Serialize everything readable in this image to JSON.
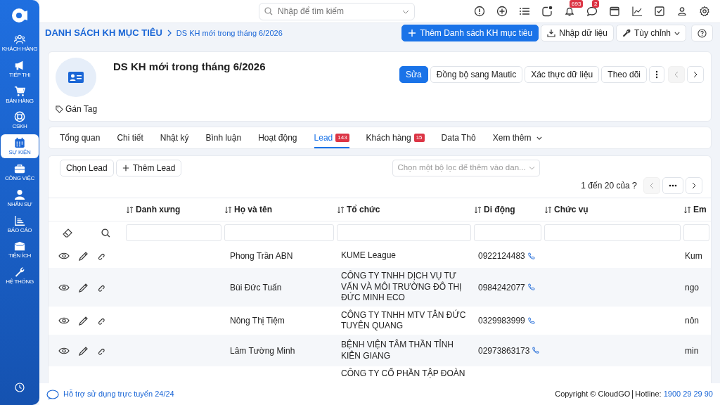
{
  "sidebar": {
    "items": [
      {
        "label": "KHÁCH HÀNG",
        "selected": false
      },
      {
        "label": "TIẾP THỊ",
        "selected": false
      },
      {
        "label": "BÁN HÀNG",
        "selected": false
      },
      {
        "label": "CSKH",
        "selected": false
      },
      {
        "label": "SỰ KIỆN",
        "selected": true
      },
      {
        "label": "CÔNG VIỆC",
        "selected": false
      },
      {
        "label": "NHÂN SỰ",
        "selected": false
      },
      {
        "label": "BÁO CÁO",
        "selected": false
      },
      {
        "label": "TIỆN ÍCH",
        "selected": false
      },
      {
        "label": "HỆ THỐNG",
        "selected": false
      }
    ]
  },
  "topbar": {
    "search": {
      "placeholder": "Nhập để tìm kiếm"
    },
    "bell_badge": "693",
    "chat_badge": "2"
  },
  "breadcrumb": [
    "DANH SÁCH KH MỤC TIÊU",
    "DS KH mới trong tháng 6/2026"
  ],
  "header_actions": [
    "Thêm Danh sách KH mục tiêu",
    "Nhập dữ liệu",
    "Tùy chỉnh"
  ],
  "record": {
    "title": "DS KH mới trong tháng 6/2026",
    "tag_label": "Gán Tag",
    "buttons": [
      {
        "label": "Sửa",
        "kind": "primary"
      },
      {
        "label": "Đồng bộ sang Mautic",
        "kind": "default"
      },
      {
        "label": "Xác thực dữ liệu",
        "kind": "default"
      },
      {
        "label": "Theo dõi",
        "kind": "default"
      }
    ]
  },
  "tabs": [
    {
      "label": "Tổng quan",
      "selected": false
    },
    {
      "label": "Chi tiết",
      "selected": false
    },
    {
      "label": "Nhật ký",
      "selected": false
    },
    {
      "label": "Bình luận",
      "selected": false
    },
    {
      "label": "Hoạt động",
      "selected": false
    },
    {
      "label": "Lead",
      "selected": true,
      "badge": "143"
    },
    {
      "label": "Khách hàng",
      "selected": false,
      "badge": "15"
    },
    {
      "label": "Data Thô",
      "selected": false
    },
    {
      "label": "Xem thêm",
      "selected": false,
      "kind": "more"
    }
  ],
  "lead_panel": {
    "buttons": [
      "Chọn Lead",
      "Thêm Lead"
    ],
    "filter": {
      "placeholder": "Chọn một bộ lọc để thêm vào dan..."
    },
    "pagination": "1 đến 20 của",
    "pagination_total": "?"
  },
  "table": {
    "columns": [
      "Danh xưng",
      "Họ và tên",
      "Tổ chức",
      "Di động",
      "Chức vụ",
      "Em"
    ],
    "rows": [
      {
        "name": "Phong Trần ABN",
        "organization": "KUME League",
        "mobile": "0922124483",
        "column_6": "Kum"
      },
      {
        "name": "Bùi Đức Tuấn",
        "organization": "CÔNG TY TNHH DỊCH VỤ TƯ VẤN VÀ MÔI TRƯỜNG ĐÔ THỊ ĐỨC MINH ECO",
        "mobile": "0984242077",
        "column_6": "ngo"
      },
      {
        "name": "Nông Thị Tiệm",
        "organization": "CÔNG TY TNHH MTV TÂN ĐỨC TUYÊN QUANG",
        "mobile": "0329983999",
        "column_6": "nôn"
      },
      {
        "name": "Lâm Tường Minh",
        "organization": "BỆNH VIỆN TÂM THẦN TỈNH KIÊN GIANG",
        "mobile": "02973863173",
        "column_6": "min"
      },
      {
        "organization": "CÔNG TY CỔ PHẦN TẬP ĐOÀN"
      }
    ]
  },
  "footer": {
    "support": "Hỗ trợ sử dụng trực tuyến 24/24",
    "copyright": "Copyright © CloudGO",
    "hotline_label": "Hotline:",
    "hotline": "1900 29 29 90"
  }
}
